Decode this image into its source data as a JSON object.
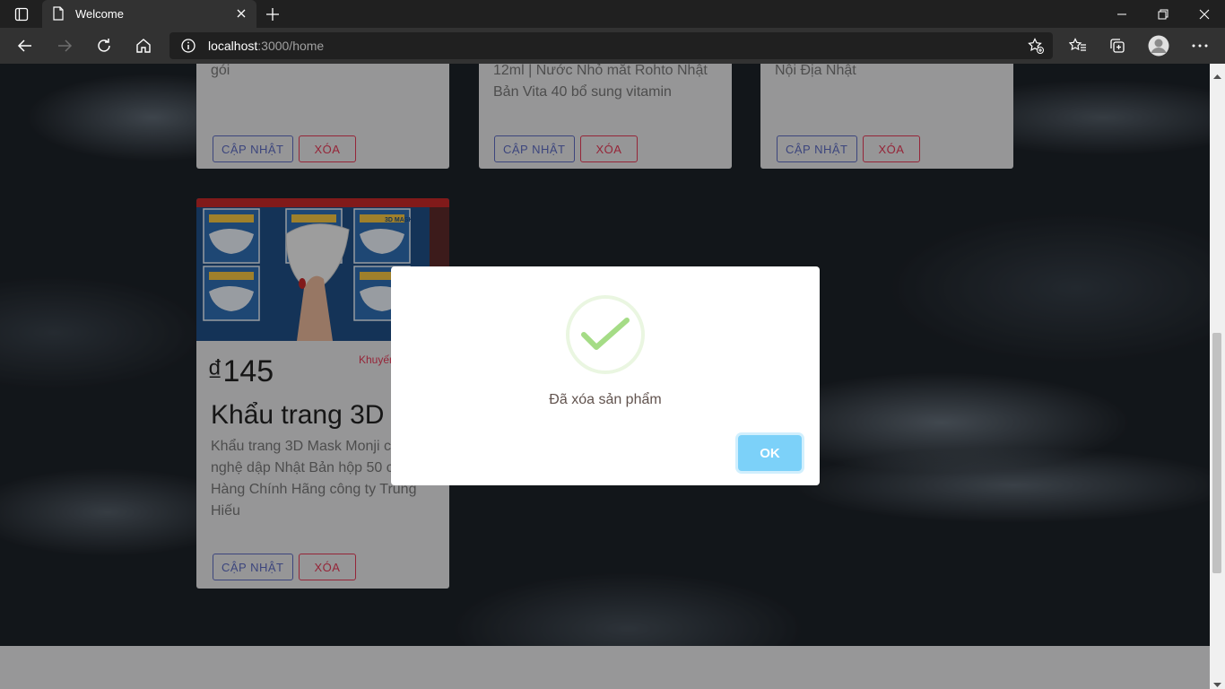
{
  "browser": {
    "tab_title": "Welcome",
    "url_host": "localhost",
    "url_path": ":3000/home"
  },
  "cards_top": [
    {
      "desc": "gói",
      "update_label": "CẬP NHẬT",
      "delete_label": "XÓA"
    },
    {
      "desc_line1": "12ml | Nước Nhỏ mắt Rohto Nhật",
      "desc_line2": "Bản Vita 40 bổ sung vitamin",
      "update_label": "CẬP NHẬT",
      "delete_label": "XÓA"
    },
    {
      "desc": "Nội Địa Nhật",
      "update_label": "CẬP NHẬT",
      "delete_label": "XÓA"
    }
  ],
  "product_card": {
    "image_label": "3D MASK",
    "price": "₫145",
    "promo": "Khuyến",
    "title": "Khẩu trang 3D",
    "desc_lines": [
      "Khẩu trang 3D Mask Monji c",
      "nghệ dập Nhật Bản hộp 50 c",
      "Hàng Chính Hãng công ty Trung",
      "Hiếu"
    ],
    "update_label": "CẬP NHẬT",
    "delete_label": "XÓA"
  },
  "modal": {
    "message": "Đã xóa sản phẩm",
    "ok_label": "OK",
    "success_color": "#a5dc86",
    "ok_color": "#7cd1f9"
  }
}
